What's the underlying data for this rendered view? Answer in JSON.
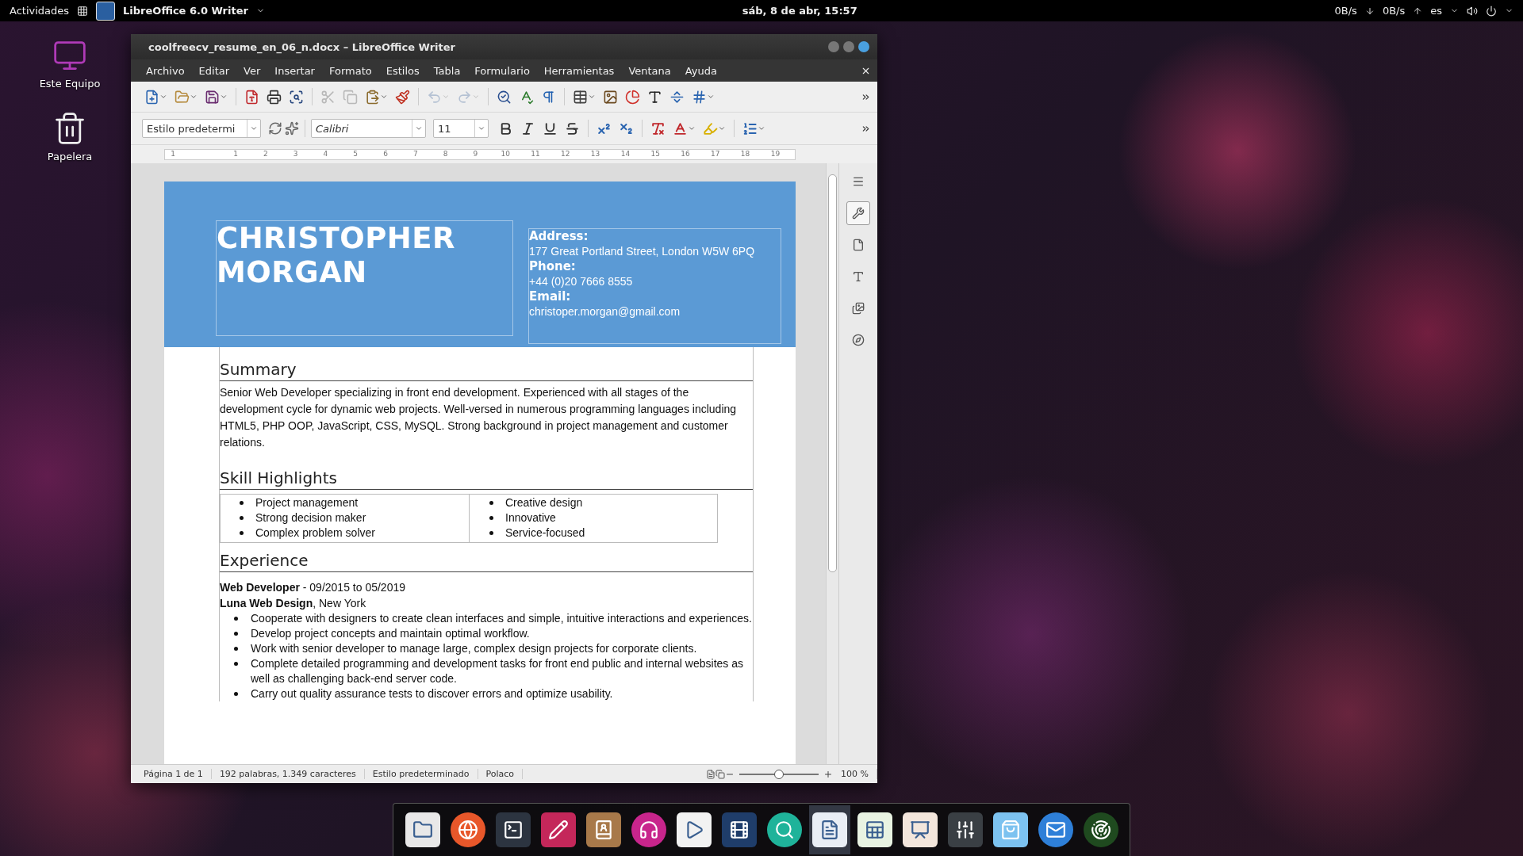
{
  "top_bar": {
    "activities": "Actividades",
    "app_name": "LibreOffice 6.0 Writer",
    "clock": "sáb,  8 de abr, 15:57",
    "download_rate": "0B/s",
    "upload_rate": "0B/s",
    "language": "es"
  },
  "desktop_icons": [
    {
      "kind": "computer",
      "label": "Este Equipo"
    },
    {
      "kind": "trash",
      "label": "Papelera"
    }
  ],
  "window": {
    "title": "coolfreecv_resume_en_06_n.docx – LibreOffice Writer"
  },
  "menu": [
    "Archivo",
    "Editar",
    "Ver",
    "Insertar",
    "Formato",
    "Estilos",
    "Tabla",
    "Formulario",
    "Herramientas",
    "Ventana",
    "Ayuda"
  ],
  "standard_toolbar": [
    {
      "kind": "new",
      "dropdown": true,
      "disabled": false
    },
    {
      "kind": "open",
      "dropdown": true,
      "disabled": false
    },
    {
      "kind": "save",
      "dropdown": true,
      "disabled": false
    },
    {
      "kind": "pdf",
      "dropdown": false,
      "disabled": false
    },
    {
      "kind": "print",
      "dropdown": false,
      "disabled": false
    },
    {
      "kind": "preview",
      "dropdown": false,
      "disabled": false
    },
    {
      "kind": "cut",
      "dropdown": false,
      "disabled": true
    },
    {
      "kind": "copy",
      "dropdown": false,
      "disabled": true
    },
    {
      "kind": "paste",
      "dropdown": true,
      "disabled": false
    },
    {
      "kind": "clone",
      "dropdown": false,
      "disabled": false
    },
    {
      "kind": "undo",
      "dropdown": true,
      "disabled": true
    },
    {
      "kind": "redo",
      "dropdown": true,
      "disabled": true
    },
    {
      "kind": "find",
      "dropdown": false,
      "disabled": false
    },
    {
      "kind": "spelling",
      "dropdown": false,
      "disabled": false
    },
    {
      "kind": "marks",
      "dropdown": false,
      "disabled": false
    },
    {
      "kind": "table",
      "dropdown": true,
      "disabled": false
    },
    {
      "kind": "image",
      "dropdown": false,
      "disabled": false
    },
    {
      "kind": "chart",
      "dropdown": false,
      "disabled": false
    },
    {
      "kind": "textbox",
      "dropdown": false,
      "disabled": false
    },
    {
      "kind": "pagebreak",
      "dropdown": false,
      "disabled": false
    },
    {
      "kind": "field",
      "dropdown": true,
      "disabled": false
    }
  ],
  "format_toolbar": {
    "paragraph_style": "Estilo predetermi",
    "font_name": "Calibri",
    "font_size": "11",
    "buttons": [
      {
        "kind": "bold",
        "dropdown": false
      },
      {
        "kind": "italic",
        "dropdown": false
      },
      {
        "kind": "underline",
        "dropdown": false
      },
      {
        "kind": "strike",
        "dropdown": false
      },
      {
        "kind": "superscript",
        "dropdown": false
      },
      {
        "kind": "subscript",
        "dropdown": false
      },
      {
        "kind": "clear",
        "dropdown": false
      },
      {
        "kind": "fontcolor",
        "dropdown": true
      },
      {
        "kind": "highlight",
        "dropdown": true
      },
      {
        "kind": "list",
        "dropdown": true
      }
    ]
  },
  "ruler": {
    "labels": [
      "1",
      "1",
      "2",
      "3",
      "4",
      "5",
      "6",
      "7",
      "8",
      "9",
      "10",
      "11",
      "12",
      "13",
      "14",
      "15",
      "16",
      "17",
      "18",
      "19"
    ]
  },
  "document": {
    "name": "CHRISTOPHER MORGAN",
    "contact": [
      {
        "label": "Address:",
        "value": "177 Great Portland Street, London W5W 6PQ"
      },
      {
        "label": "Phone:",
        "value": "+44 (0)20 7666 8555"
      },
      {
        "label": "Email:",
        "value": "christoper.morgan@gmail.com"
      }
    ],
    "summary": {
      "heading": "Summary",
      "text": "Senior Web Developer specializing in front end development. Experienced with all stages of the development cycle for dynamic web projects. Well-versed in numerous programming languages including HTML5, PHP OOP, JavaScript, CSS, MySQL. Strong background in project management and customer relations."
    },
    "skills": {
      "heading": "Skill Highlights",
      "columns": [
        [
          "Project management",
          "Strong decision maker",
          "Complex problem solver"
        ],
        [
          "Creative design",
          "Innovative",
          "Service-focused"
        ]
      ]
    },
    "experience": {
      "heading": "Experience",
      "role": "**Web Developer** - 09/2015 to 05/2019",
      "company": "**Luna Web Design**, New York",
      "bullets": [
        "Cooperate with designers to create clean interfaces and simple, intuitive interactions and experiences.",
        "Develop project concepts and maintain optimal workflow.",
        "Work with senior developer to manage large, complex design projects for corporate clients.",
        "Complete detailed programming and development tasks for front end public and internal websites as well as challenging back-end server code.",
        "Carry out quality assurance tests to discover errors and optimize usability."
      ]
    }
  },
  "sidebar": [
    {
      "kind": "menu",
      "selected": false
    },
    {
      "kind": "properties",
      "selected": true
    },
    {
      "kind": "page",
      "selected": false
    },
    {
      "kind": "styles",
      "selected": false
    },
    {
      "kind": "gallery",
      "selected": false
    },
    {
      "kind": "navigator",
      "selected": false
    }
  ],
  "status_bar": {
    "page": "Página 1 de 1",
    "counts": "192 palabras, 1.349 caracteres",
    "style": "Estilo predeterminado",
    "language": "Polaco",
    "zoom": {
      "level": 0.5,
      "reading": "100 %"
    }
  },
  "dock": [
    {
      "kind": "files",
      "selected": false
    },
    {
      "kind": "browser",
      "selected": false
    },
    {
      "kind": "terminal",
      "selected": false
    },
    {
      "kind": "editor",
      "selected": false
    },
    {
      "kind": "contacts",
      "selected": false
    },
    {
      "kind": "music",
      "selected": false
    },
    {
      "kind": "player",
      "selected": false
    },
    {
      "kind": "video",
      "selected": false
    },
    {
      "kind": "search",
      "selected": false
    },
    {
      "kind": "writer",
      "selected": true
    },
    {
      "kind": "calc",
      "selected": false
    },
    {
      "kind": "impress",
      "selected": false
    },
    {
      "kind": "mixer",
      "selected": false
    },
    {
      "kind": "store",
      "selected": false
    },
    {
      "kind": "mail",
      "selected": false
    },
    {
      "kind": "radar",
      "selected": false
    }
  ]
}
